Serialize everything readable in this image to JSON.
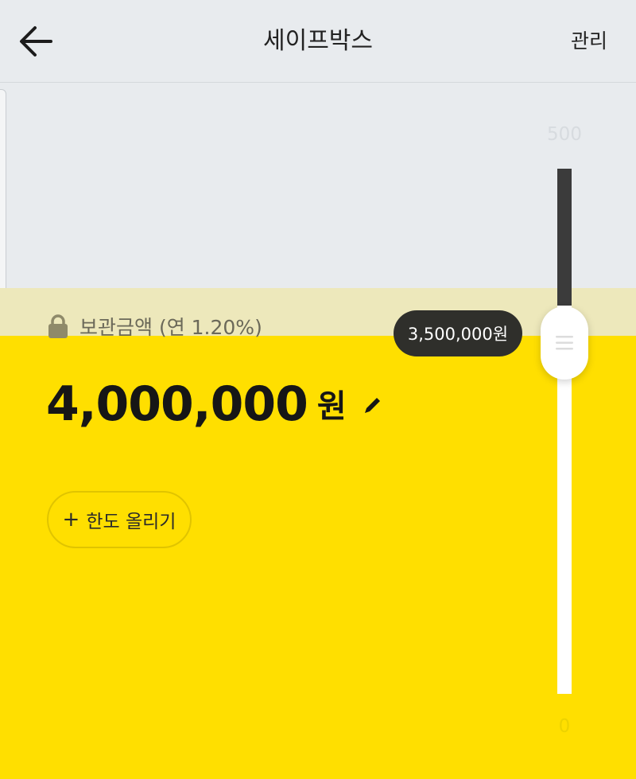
{
  "header": {
    "back_icon": "arrow-left-icon",
    "title": "세이프박스",
    "manage_label": "관리"
  },
  "safebox": {
    "lock_icon": "lock-icon",
    "stored_label": "보관금액 (연 1.20%)",
    "amount": "4,000,000",
    "currency": "원",
    "edit_icon": "pencil-icon",
    "raise_limit_label": "한도 올리기",
    "raise_limit_icon": "plus-icon"
  },
  "slider": {
    "max_label": "500",
    "min_label": "0",
    "current_value_label": "3,500,000원",
    "fill_fraction": 0.74,
    "grip_icon": "drag-handle-icon"
  },
  "colors": {
    "accent_yellow": "#ffdf00",
    "band_tint": "#ede8bb",
    "background": "#e8ebee",
    "tooltip_bg": "#2f2f2b",
    "track_dark": "#3b3b3b"
  }
}
